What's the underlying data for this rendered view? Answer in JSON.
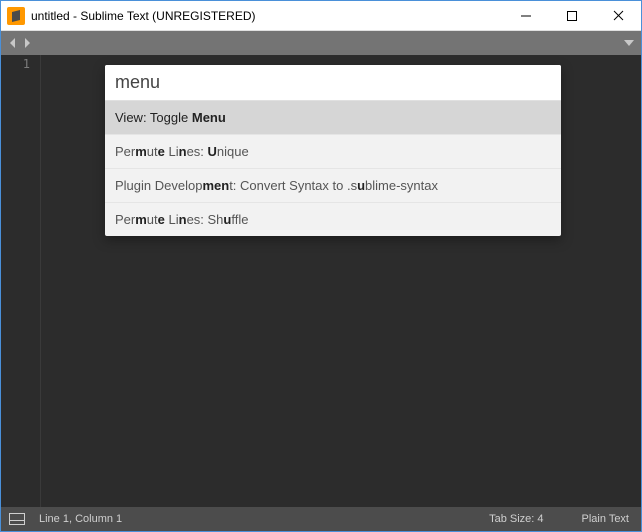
{
  "window": {
    "title": "untitled - Sublime Text (UNREGISTERED)"
  },
  "editor": {
    "line_number": "1"
  },
  "palette": {
    "query": "menu",
    "items": [
      {
        "html": "View: Toggle <b>Menu</b>",
        "selected": true
      },
      {
        "html": "Per<b>m</b>ut<b>e</b> Li<b>n</b>es: <b>U</b>nique",
        "selected": false
      },
      {
        "html": "Plugin Develop<b>men</b>t: Convert Syntax to .s<b>u</b>blime-syntax",
        "selected": false
      },
      {
        "html": "Per<b>m</b>ut<b>e</b> Li<b>n</b>es: Sh<b>u</b>ffle",
        "selected": false
      }
    ]
  },
  "status": {
    "position": "Line 1, Column 1",
    "tab_size": "Tab Size: 4",
    "language": "Plain Text"
  }
}
